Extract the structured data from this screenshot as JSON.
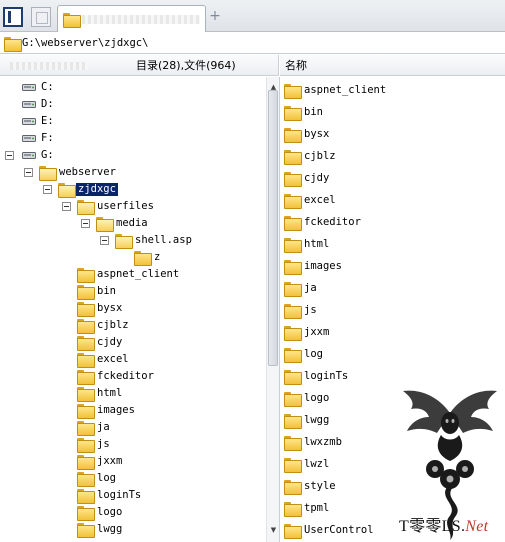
{
  "tabs": {
    "active_tab_label": "",
    "new_tab_symbol": "+"
  },
  "address": {
    "path": "G:\\webserver\\zjdxgc\\"
  },
  "left_header": {
    "counts": "目录(28),文件(964)"
  },
  "right_header": {
    "name_column": "名称"
  },
  "tree": {
    "drives": [
      "C:",
      "D:",
      "E:",
      "F:",
      "G:"
    ],
    "webserver": "webserver",
    "zjdxgc": "zjdxgc",
    "userfiles": "userfiles",
    "media": "media",
    "shell": "shell.asp",
    "z": "z",
    "children": [
      "aspnet_client",
      "bin",
      "bysx",
      "cjblz",
      "cjdy",
      "excel",
      "fckeditor",
      "html",
      "images",
      "ja",
      "js",
      "jxxm",
      "log",
      "loginTs",
      "logo",
      "lwgg"
    ]
  },
  "list": {
    "items": [
      "aspnet_client",
      "bin",
      "bysx",
      "cjblz",
      "cjdy",
      "excel",
      "fckeditor",
      "html",
      "images",
      "ja",
      "js",
      "jxxm",
      "log",
      "loginTs",
      "logo",
      "lwgg",
      "lwxzmb",
      "lwzl",
      "style",
      "tpml",
      "UserControl"
    ]
  },
  "watermark": {
    "brand_prefix": "T零零LS.",
    "brand_suffix": "Net"
  },
  "icons": {
    "folder": "folder-icon",
    "drive": "hard-drive-icon",
    "expander": "collapse-icon",
    "scroll_up": "scroll-up-arrow-icon",
    "scroll_down": "scroll-down-arrow-icon"
  },
  "colors": {
    "selection": "#0a246a",
    "folder": "#f2c13a"
  }
}
